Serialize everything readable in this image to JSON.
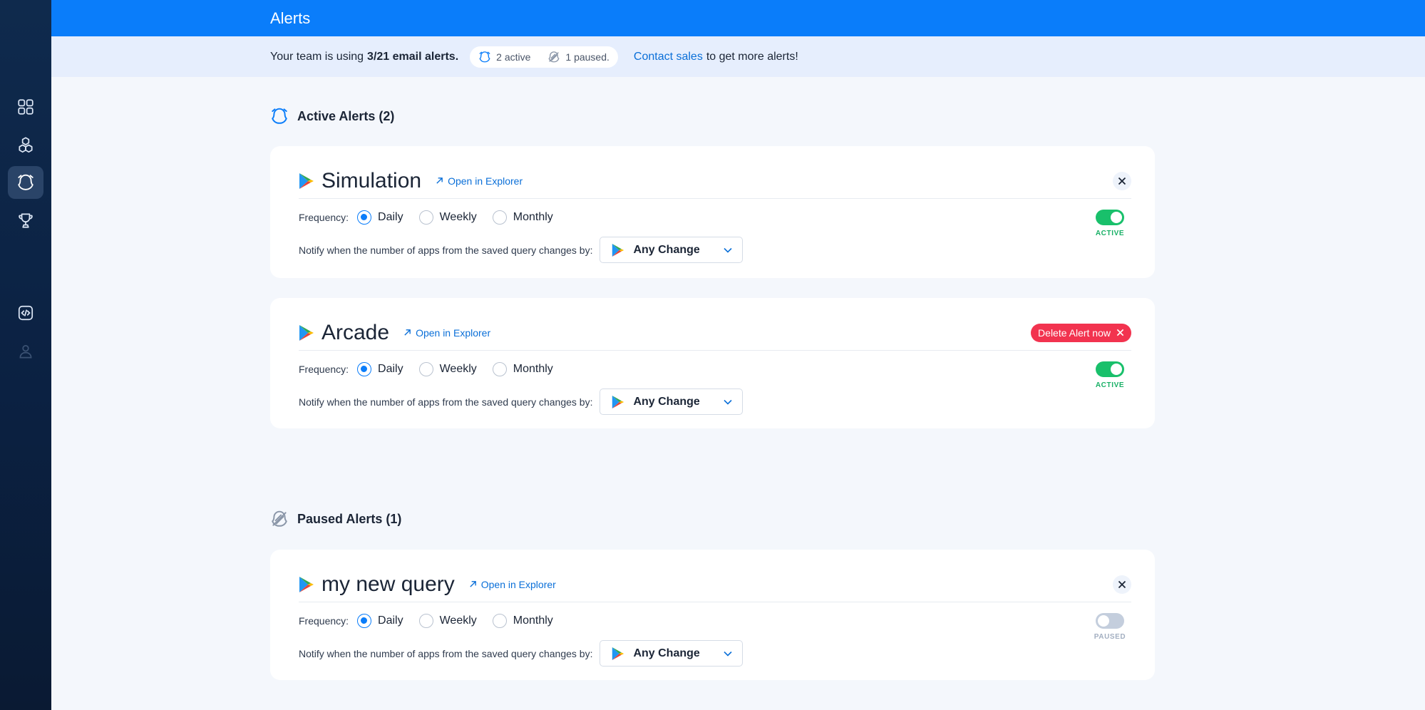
{
  "header": {
    "title": "Alerts"
  },
  "usage": {
    "prefix": "Your team is using",
    "count_text": "3/21 email alerts.",
    "active_text": "2 active",
    "paused_text": "1 paused.",
    "contact_link": "Contact sales",
    "suffix": "to get more alerts!"
  },
  "sections": {
    "active_title": "Active Alerts (2)",
    "paused_title": "Paused Alerts (1)"
  },
  "common": {
    "open_in_explorer": "Open in Explorer",
    "frequency_label": "Frequency:",
    "freq_daily": "Daily",
    "freq_weekly": "Weekly",
    "freq_monthly": "Monthly",
    "notify_text": "Notify when the number of apps from the saved query changes by:"
  },
  "alerts": [
    {
      "name": "Simulation",
      "frequency": "Daily",
      "change": "Any Change",
      "status": "ACTIVE",
      "enabled": true
    },
    {
      "name": "Arcade",
      "frequency": "Daily",
      "change": "Any Change",
      "status": "ACTIVE",
      "enabled": true,
      "delete_label": "Delete Alert now"
    },
    {
      "name": "my new query",
      "frequency": "Daily",
      "change": "Any Change",
      "status": "PAUSED",
      "enabled": false
    }
  ],
  "colors": {
    "primary": "#0a7dfa",
    "active_green": "#19c06b",
    "danger": "#f2334f",
    "sidebar": "#0b2142"
  },
  "icons": {
    "sidebar": [
      "dashboard-grid-icon",
      "cubes-icon",
      "alert-bell-icon",
      "trophy-icon",
      "code-window-icon",
      "user-icon"
    ]
  }
}
